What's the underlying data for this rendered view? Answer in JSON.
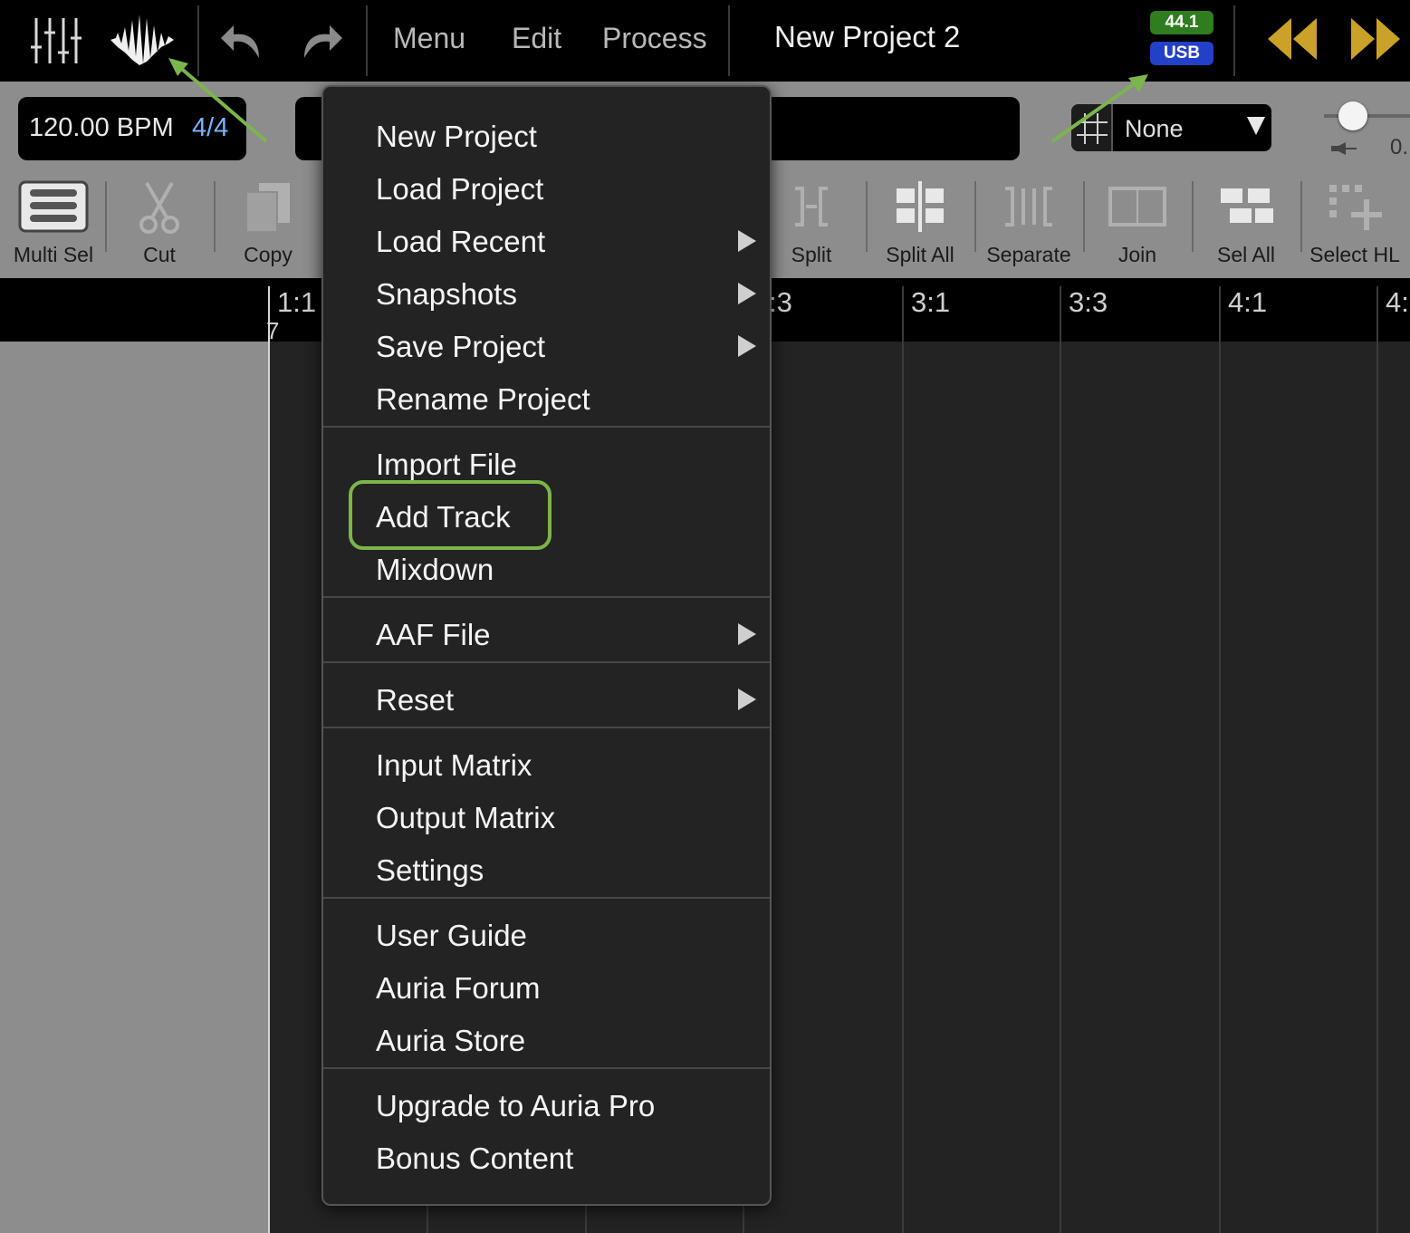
{
  "topbar": {
    "menus": [
      "Menu",
      "Edit",
      "Process"
    ],
    "project_title": "New Project 2",
    "badges": {
      "sample_rate": "44.1",
      "interface": "USB"
    },
    "colors": {
      "transport": "#c9a227",
      "badge_green": "#2f7d1f",
      "badge_blue": "#2340c8"
    }
  },
  "tempo": {
    "bpm": "120.00 BPM",
    "time_signature": "4/4"
  },
  "grid": {
    "value": "None"
  },
  "slider": {
    "value_label": "0."
  },
  "toolbar": {
    "tools": [
      "Multi Sel",
      "Cut",
      "Copy",
      "Split",
      "Split All",
      "Separate",
      "Join",
      "Sel All",
      "Select HL"
    ]
  },
  "ruler": {
    "marks": [
      "1:1",
      "7",
      ":3",
      "3:1",
      "3:3",
      "4:1",
      "4:"
    ]
  },
  "menu": {
    "items": [
      "New Project",
      "Load Project",
      "Load Recent",
      "Snapshots",
      "Save Project",
      "Rename Project",
      "Import File",
      "Add Track",
      "Mixdown",
      "AAF File",
      "Reset",
      "Input Matrix",
      "Output Matrix",
      "Settings",
      "User Guide",
      "Auria Forum",
      "Auria Store",
      "Upgrade to Auria Pro",
      "Bonus Content"
    ],
    "highlighted": "Add Track",
    "highlight_color": "#7bb54c"
  }
}
